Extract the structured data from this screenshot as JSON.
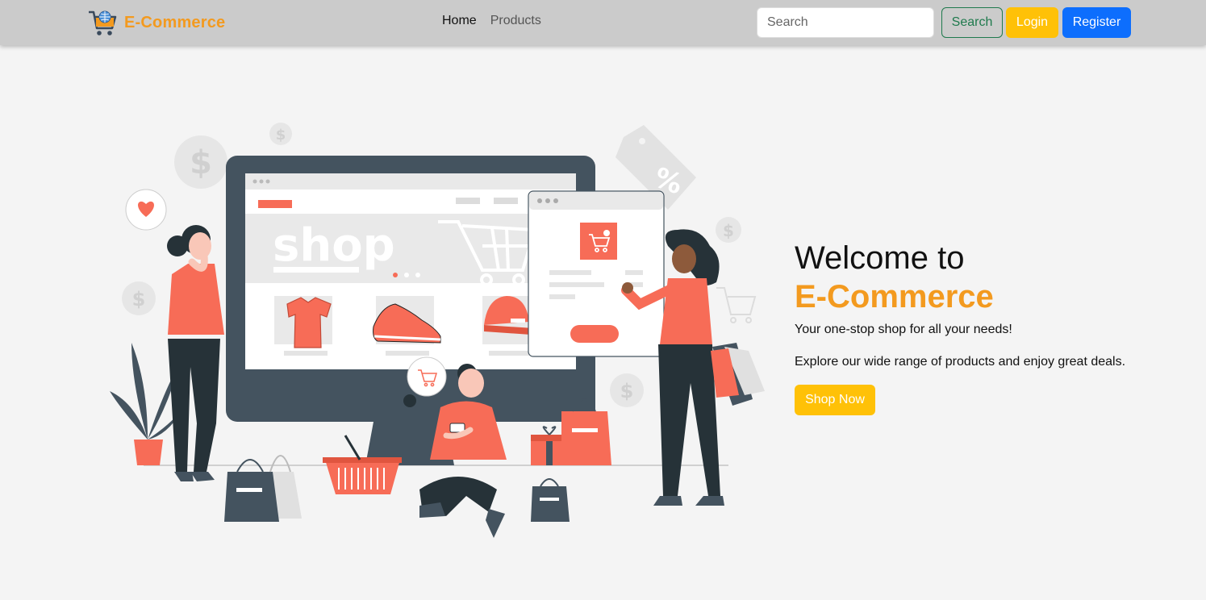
{
  "brand": {
    "name": "E-Commerce",
    "icon": "shopping-cart-globe-icon",
    "color": "#f39a1f"
  },
  "nav": {
    "links": [
      {
        "label": "Home",
        "active": true
      },
      {
        "label": "Products",
        "active": false
      }
    ]
  },
  "search": {
    "placeholder": "Search",
    "value": "",
    "button_label": "Search"
  },
  "auth": {
    "login_label": "Login",
    "register_label": "Register"
  },
  "hero": {
    "title_line1": "Welcome to",
    "title_line2": "E-Commerce",
    "tagline": "Your one-stop shop for all your needs!",
    "description": "Explore our wide range of products and enjoy great deals.",
    "cta_label": "Shop Now"
  },
  "illustration": {
    "screen_text": "shop"
  },
  "colors": {
    "navbar": "#cbcbcb",
    "accent": "#f39a1f",
    "warning": "#ffc107",
    "primary": "#0d6efd",
    "success": "#1f7a4d",
    "coral": "#f76c57"
  }
}
